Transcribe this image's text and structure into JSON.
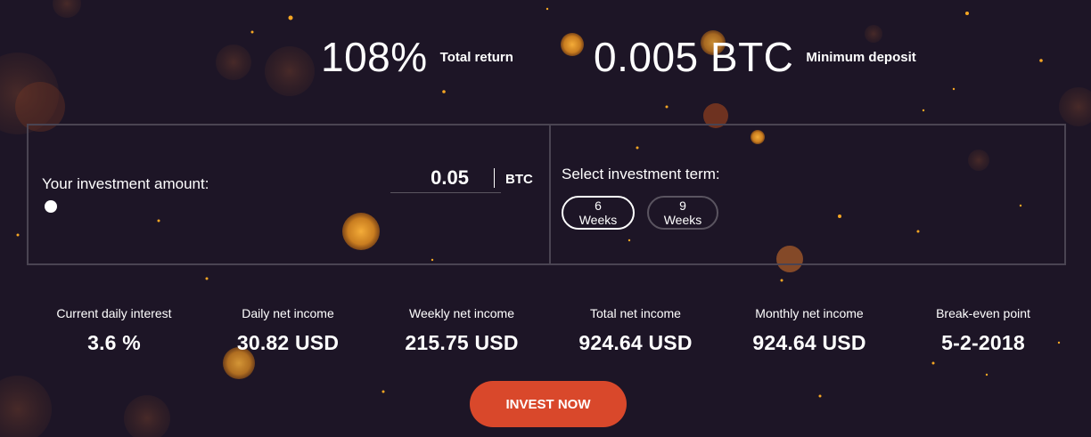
{
  "summary": {
    "total_return_value": "108%",
    "total_return_label": "Total return",
    "min_deposit_value": "0.005 BTC",
    "min_deposit_label": "Minimum deposit"
  },
  "calculator": {
    "amount_label": "Your investment amount:",
    "amount_value": "0.05",
    "amount_unit": "BTC",
    "slider_level": 0.0,
    "term_label": "Select investment term:",
    "terms": [
      {
        "label": "6 Weeks",
        "selected": true
      },
      {
        "label": "9 Weeks",
        "selected": false
      }
    ]
  },
  "metrics": [
    {
      "label": "Current daily interest",
      "value": "3.6 %"
    },
    {
      "label": "Daily net income",
      "value": "30.82 USD"
    },
    {
      "label": "Weekly net income",
      "value": "215.75 USD"
    },
    {
      "label": "Total net income",
      "value": "924.64 USD"
    },
    {
      "label": "Monthly net income",
      "value": "924.64 USD"
    },
    {
      "label": "Break-even point",
      "value": "5-2-2018"
    }
  ],
  "cta": {
    "invest_label": "INVEST NOW"
  },
  "colors": {
    "background": "#1d1526",
    "accent": "#d9482b",
    "border": "#4a4452",
    "bokeh": "#f5a623"
  }
}
